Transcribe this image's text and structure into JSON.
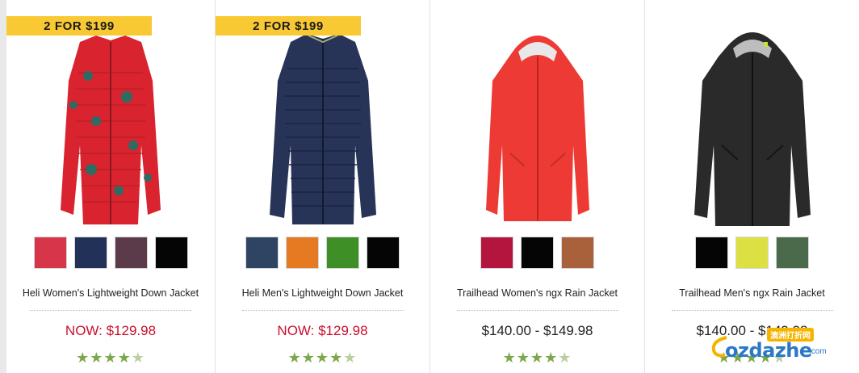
{
  "products": [
    {
      "promo": "2 FOR $199",
      "name": "Heli Women's Lightweight Down Jacket",
      "price": "NOW: $129.98",
      "price_style": "sale",
      "rating": 4.5,
      "swatches": [
        "#d7364a",
        "#223157",
        "#5b3a4a",
        "#050505"
      ],
      "image": "red-down-jacket"
    },
    {
      "promo": "2 FOR $199",
      "name": "Heli Men's Lightweight Down Jacket",
      "price": "NOW: $129.98",
      "price_style": "sale",
      "rating": 4.5,
      "swatches": [
        "#2f4363",
        "#e57a22",
        "#3e8f26",
        "#050505"
      ],
      "image": "navy-down-jacket"
    },
    {
      "promo": "",
      "name": "Trailhead Women's ngx Rain Jacket",
      "price": "$140.00 - $149.98",
      "price_style": "regular",
      "rating": 4.5,
      "swatches": [
        "#b3153f",
        "#050505",
        "#a8613a"
      ],
      "image": "red-rain-jacket"
    },
    {
      "promo": "",
      "name": "Trailhead Men's ngx Rain Jacket",
      "price": "$140.00 - $149.98",
      "price_style": "regular",
      "rating": 4.5,
      "swatches": [
        "#050505",
        "#dde043",
        "#4b6a4c"
      ],
      "image": "black-rain-jacket"
    }
  ],
  "watermark": {
    "text": "ozdazhe",
    "domain": ".com",
    "tag": "澳洲打折网"
  }
}
